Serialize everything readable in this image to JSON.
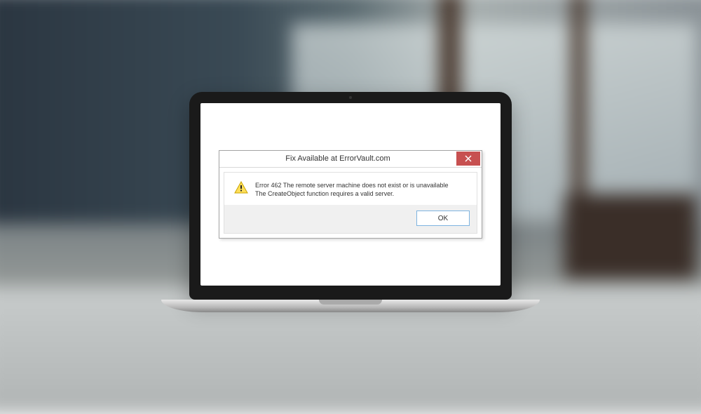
{
  "dialog": {
    "title": "Fix Available at ErrorVault.com",
    "message_line1": "Error 462 The remote server machine does not exist or is unavailable",
    "message_line2": "The CreateObject function requires a valid server.",
    "ok_label": "OK",
    "close_icon": "close-icon",
    "warning_icon": "warning-icon"
  },
  "colors": {
    "close_bg": "#c75050",
    "ok_border": "#7eb4e0"
  }
}
